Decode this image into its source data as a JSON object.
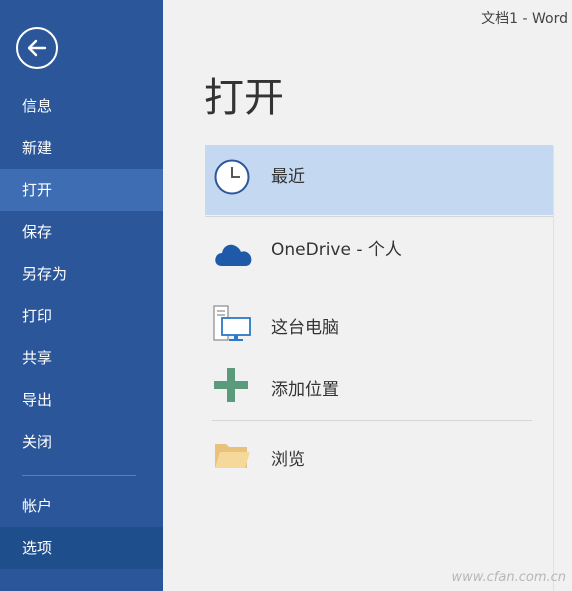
{
  "window": {
    "title": "文档1 - Word"
  },
  "sidebar": {
    "back_label": "",
    "items": [
      {
        "label": "信息"
      },
      {
        "label": "新建"
      },
      {
        "label": "打开"
      },
      {
        "label": "保存"
      },
      {
        "label": "另存为"
      },
      {
        "label": "打印"
      },
      {
        "label": "共享"
      },
      {
        "label": "导出"
      },
      {
        "label": "关闭"
      },
      {
        "label": "帐户"
      },
      {
        "label": "选项"
      }
    ]
  },
  "main": {
    "title": "打开",
    "locations": [
      {
        "label": "最近",
        "icon": "clock-icon"
      },
      {
        "label": "OneDrive - 个人",
        "icon": "cloud-icon"
      },
      {
        "label": "这台电脑",
        "icon": "computer-icon"
      },
      {
        "label": "添加位置",
        "icon": "plus-icon"
      },
      {
        "label": "浏览",
        "icon": "folder-icon"
      }
    ]
  },
  "watermark": "www.cfan.com.cn",
  "colors": {
    "sidebar": "#2b579a",
    "sidebar_active": "#3e6db4",
    "sidebar_selected": "#1f4e8c",
    "highlight": "#c5d8f1"
  }
}
